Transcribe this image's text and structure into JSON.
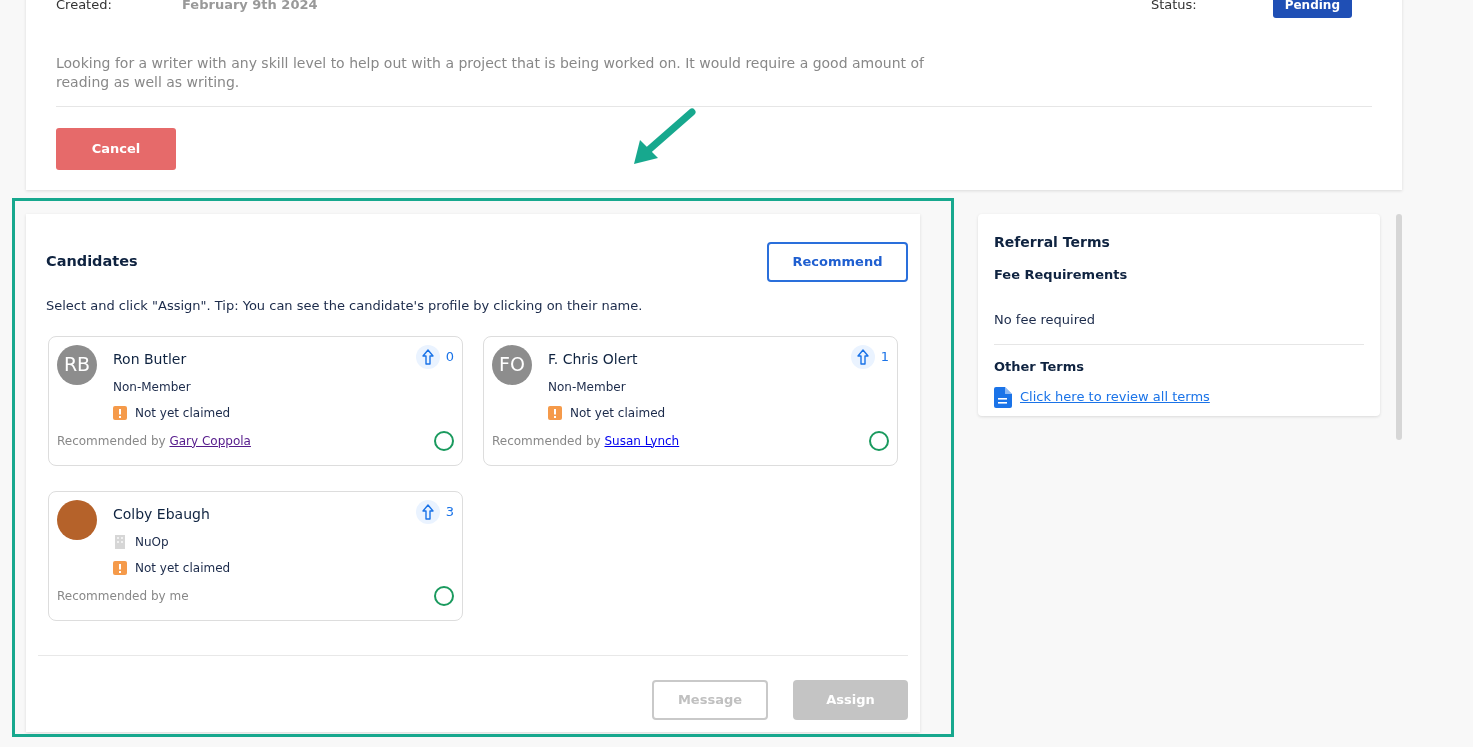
{
  "request": {
    "created_label": "Created:",
    "created_value": "February 9th 2024",
    "status_label": "Status:",
    "status": "Pending",
    "description": "Looking for a writer with any skill level to help out with a project that is being worked on. It would require a good amount of reading as well as writing.",
    "cancel_button": "Cancel"
  },
  "candidates": {
    "title": "Candidates",
    "recommend_button": "Recommend",
    "instructions": "Select and click \"Assign\". Tip: You can see the candidate's profile by clicking on their name.",
    "items": [
      {
        "name": "Ron Butler",
        "avatar": {
          "kind": "initials",
          "text": "RB"
        },
        "org": {
          "kind": "membership",
          "text": "Non-Member"
        },
        "claim_status": "Not yet claimed",
        "votes": "0",
        "recommended_prefix": "Recommended by",
        "recommended_by": "Gary Coppola",
        "link_visited": true,
        "selected": false
      },
      {
        "name": "F. Chris Olert",
        "avatar": {
          "kind": "initials",
          "text": "FO"
        },
        "org": {
          "kind": "membership",
          "text": "Non-Member"
        },
        "claim_status": "Not yet claimed",
        "votes": "1",
        "recommended_prefix": "Recommended by",
        "recommended_by": "Susan Lynch",
        "link_visited": false,
        "selected": false
      },
      {
        "name": "Colby Ebaugh",
        "avatar": {
          "kind": "photo"
        },
        "org": {
          "kind": "company",
          "text": "NuOp"
        },
        "claim_status": "Not yet claimed",
        "votes": "3",
        "recommended_prefix": "Recommended by me",
        "selected": false
      }
    ],
    "buttons": [
      {
        "label": "Message",
        "kind": "outline",
        "disabled": true
      },
      {
        "label": "Assign",
        "kind": "solid",
        "disabled": true
      }
    ]
  },
  "referral_terms": {
    "title": "Referral Terms",
    "fee_heading": "Fee Requirements",
    "fee_text": "No fee required",
    "other_heading": "Other Terms",
    "terms_link": "Click here to review all terms"
  }
}
